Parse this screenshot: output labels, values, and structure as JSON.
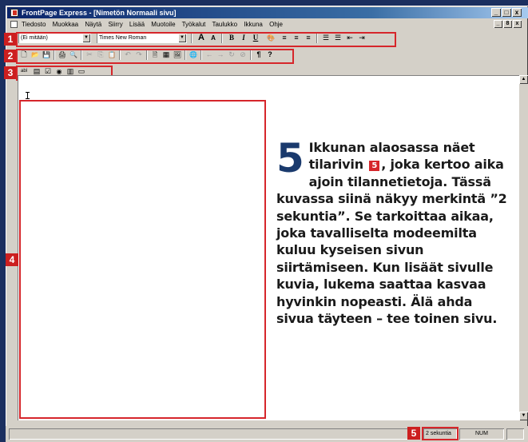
{
  "window": {
    "title": "FrontPage Express - [Nimetön Normaali sivu]",
    "controls": [
      "_",
      "□",
      "x"
    ]
  },
  "menu": {
    "items": [
      "Tiedosto",
      "Muokkaa",
      "Näytä",
      "Siirry",
      "Lisää",
      "Muotoile",
      "Työkalut",
      "Taulukko",
      "Ikkuna",
      "Ohje"
    ],
    "mdi_controls": [
      "_",
      "8",
      "x"
    ]
  },
  "badges": {
    "b1": "1",
    "b2": "2",
    "b3": "3",
    "b4": "4",
    "b5": "5"
  },
  "toolbar1": {
    "style_value": "(Ei mitään)",
    "font_value": "Times New Roman",
    "buttons": [
      "A",
      "A",
      "B",
      "I",
      "U",
      "🎨",
      "≡",
      "≡",
      "≡",
      "☰",
      "☰",
      "⇤",
      "⇥"
    ]
  },
  "toolbar2": {
    "buttons": [
      "🗋",
      "📂",
      "💾",
      "🖨",
      "🔍",
      "✂",
      "⎘",
      "📋",
      "↶",
      "↷",
      "🗎",
      "▦",
      "🖼",
      "🌐",
      "←",
      "→",
      "↻",
      "⊘",
      "¶",
      "?"
    ]
  },
  "toolbar3": {
    "buttons": [
      "abl",
      "▤",
      "☑",
      "◉",
      "▥",
      "▭"
    ]
  },
  "caption": {
    "number": "5",
    "lead": "Ikkunan alaosassa näet tilarivin",
    "badge": "5",
    "rest": ", joka kertoo aika ajoin tilannetietoja. Tässä kuvassa siinä näkyy merkintä ”2 sekuntia”. Se tarkoittaa aikaa, joka tavalliselta modeemilta kuluu kyseisen sivun siirtämiseen. Kun lisäät sivulle kuvia, lukema saattaa kasvaa hyvinkin nopeasti. Älä ahda sivua täyteen – tee toinen sivu."
  },
  "status": {
    "time": "2 sekuntia",
    "num": "NUM"
  },
  "colors": {
    "accent_red": "#d6262b",
    "title_blue": "#0a246a",
    "background": "#1b2f5f"
  }
}
